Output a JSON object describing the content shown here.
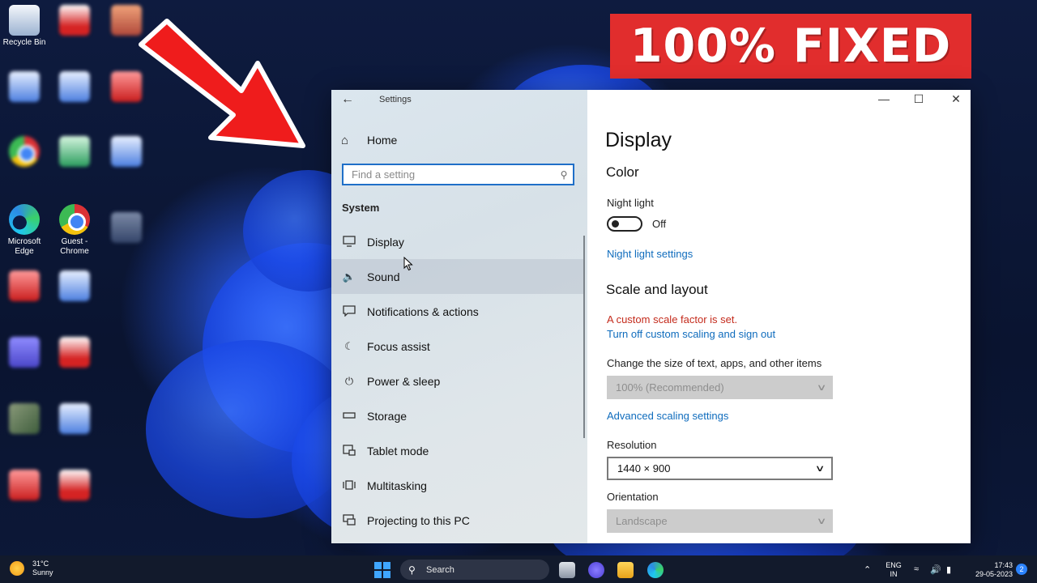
{
  "badge": {
    "text": "100% FIXED",
    "color": "#e12d2d"
  },
  "desktop": {
    "icons": [
      {
        "label": "Recycle Bin",
        "icon": "recycle-bin-icon"
      },
      {
        "label": "Microsoft Edge",
        "icon": "edge-icon"
      },
      {
        "label": "Guest - Chrome",
        "icon": "chrome-icon"
      }
    ]
  },
  "window": {
    "title": "Settings",
    "controls": {
      "minimize": "—",
      "maximize": "☐",
      "close": "✕"
    },
    "nav": {
      "home": "Home",
      "search_placeholder": "Find a setting",
      "section": "System",
      "items": [
        {
          "label": "Display",
          "icon": "monitor-icon"
        },
        {
          "label": "Sound",
          "icon": "speaker-icon"
        },
        {
          "label": "Notifications & actions",
          "icon": "notification-icon"
        },
        {
          "label": "Focus assist",
          "icon": "moon-icon"
        },
        {
          "label": "Power & sleep",
          "icon": "power-icon"
        },
        {
          "label": "Storage",
          "icon": "storage-icon"
        },
        {
          "label": "Tablet mode",
          "icon": "tablet-mode-icon"
        },
        {
          "label": "Multitasking",
          "icon": "multitasking-icon"
        },
        {
          "label": "Projecting to this PC",
          "icon": "projecting-icon"
        }
      ]
    },
    "main": {
      "page_title": "Display",
      "color_heading": "Color",
      "night_light_label": "Night light",
      "night_light_state": "Off",
      "night_light_link": "Night light settings",
      "scale_heading": "Scale and layout",
      "custom_scale_warning": "A custom scale factor is set.",
      "custom_scale_link": "Turn off custom scaling and sign out",
      "size_label": "Change the size of text, apps, and other items",
      "size_value": "100% (Recommended)",
      "advanced_link": "Advanced scaling settings",
      "resolution_label": "Resolution",
      "resolution_value": "1440 × 900",
      "orientation_label": "Orientation",
      "orientation_value": "Landscape"
    }
  },
  "taskbar": {
    "weather_temp": "31°C",
    "weather_desc": "Sunny",
    "search_label": "Search",
    "lang_line1": "ENG",
    "lang_line2": "IN",
    "time": "17:43",
    "date": "29-05-2023",
    "notification_count": "2"
  }
}
